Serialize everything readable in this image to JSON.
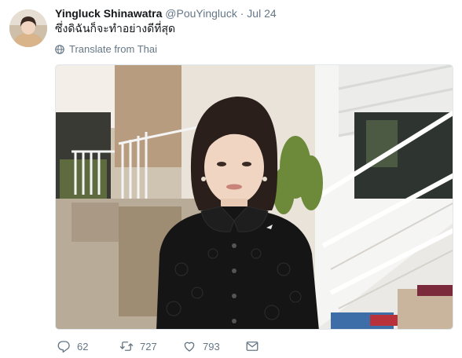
{
  "tweet": {
    "author_name": "Yingluck Shinawatra",
    "handle": "@PouYingluck",
    "separator": "·",
    "time": "Jul 24",
    "text": "ซึ่งดิฉันก็จะทำอย่างดีที่สุด",
    "translate_label": "Translate from Thai"
  },
  "actions": {
    "replies": "62",
    "retweets": "727",
    "likes": "793"
  },
  "icons": {
    "translate": "globe-icon",
    "reply": "reply-icon",
    "retweet": "retweet-icon",
    "like": "heart-icon",
    "message": "envelope-icon"
  },
  "colors": {
    "text": "#14171a",
    "muted": "#657786",
    "border": "#e1e8ed"
  }
}
